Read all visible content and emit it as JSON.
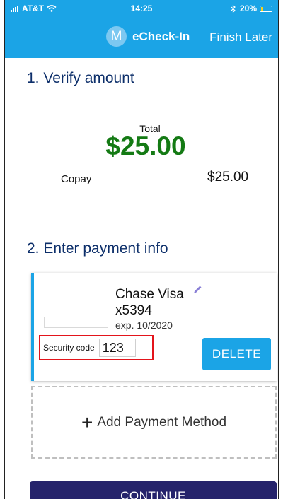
{
  "status_bar": {
    "carrier": "AT&T",
    "time": "14:25",
    "battery_text": "20%",
    "battery_level": 0.2
  },
  "header": {
    "avatar_letter": "M",
    "title": "eCheck-In",
    "finish_later": "Finish Later"
  },
  "section1": {
    "title": "1. Verify amount",
    "total_label": "Total",
    "total_amount": "$25.00",
    "copay_label": "Copay",
    "copay_value": "$25.00"
  },
  "section2": {
    "title": "2. Enter payment info",
    "card": {
      "name": "Chase Visa",
      "number": "x5394",
      "expiration": "exp. 10/2020",
      "security_code_label": "Security code",
      "security_code_value": "123",
      "delete_label": "DELETE"
    },
    "add_payment_label": "Add Payment Method"
  },
  "continue_label": "CONTINUE",
  "colors": {
    "brand": "#1ba4e6",
    "total_green": "#147a14",
    "heading_navy": "#0d2f6a",
    "continue_bg": "#25236b",
    "highlight_red": "#e3141b",
    "edit_icon": "#8a80d6"
  },
  "icons": {
    "signal": "signal-bars-icon",
    "wifi": "wifi-icon",
    "bluetooth": "bluetooth-icon",
    "battery": "battery-icon",
    "edit": "pencil-icon",
    "add": "plus-icon"
  }
}
